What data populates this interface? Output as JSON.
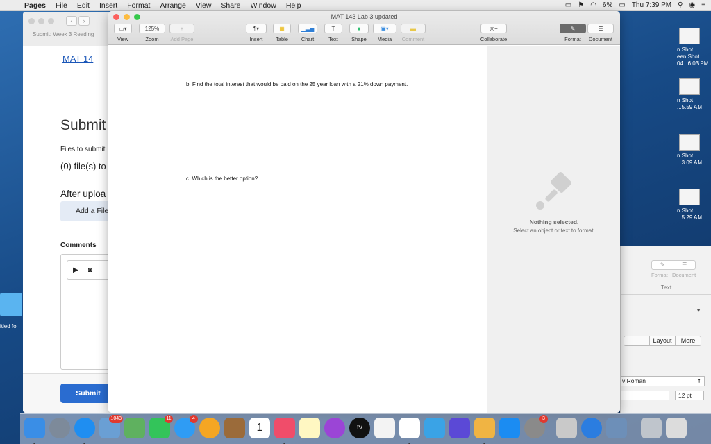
{
  "menubar": {
    "app": "Pages",
    "items": [
      "File",
      "Edit",
      "Insert",
      "Format",
      "Arrange",
      "View",
      "Share",
      "Window",
      "Help"
    ],
    "battery": "6%",
    "clock": "Thu 7:39 PM"
  },
  "browser": {
    "tab_label": "Submit: Week 3 Reading",
    "doc_link": "MAT 14",
    "heading": "Submit",
    "files_label": "Files to submit",
    "files_count": "(0) file(s) to",
    "after_upload": "After uploa",
    "add_file": "Add a File",
    "comments": "Comments",
    "submit": "Submit"
  },
  "desktop": {
    "folder_label": "itled fo",
    "shots": [
      {
        "l1": "n Shot",
        "l2": "een Shot",
        "l3": "04...6.03 PM"
      },
      {
        "l1": "n Shot",
        "l2": "...5.59 AM",
        "l3": ""
      },
      {
        "l1": "n Shot",
        "l2": "...3.09 AM",
        "l3": ""
      },
      {
        "l1": "n Shot",
        "l2": "...5.29 AM",
        "l3": ""
      }
    ]
  },
  "inspector": {
    "format": "Format",
    "document": "Document",
    "text_tab": "Text",
    "layout": "Layout",
    "more": "More",
    "font": "v Roman",
    "size": "12 pt"
  },
  "pages": {
    "title": "MAT 143 Lab 3 updated",
    "toolbar": {
      "view": "View",
      "zoom": "Zoom",
      "zoom_value": "125%",
      "add_page": "Add Page",
      "insert": "Insert",
      "table": "Table",
      "chart": "Chart",
      "text": "Text",
      "shape": "Shape",
      "media": "Media",
      "comment": "Comment",
      "collaborate": "Collaborate",
      "format": "Format",
      "document": "Document",
      "add_page_tab": "Add Page..."
    },
    "question_b": "b.   Find the total interest that would be paid on the 25 year loan with a 21% down payment.",
    "question_c": "c.   Which is the better option?",
    "nothing_selected": "Nothing selected.",
    "nothing_hint": "Select an object or text to format."
  },
  "dock": {
    "badges": {
      "photos_app": "1043",
      "facetime": "11",
      "messages": "4",
      "prefs": "3"
    },
    "calendar_day": "1",
    "tv_label": "tv"
  }
}
